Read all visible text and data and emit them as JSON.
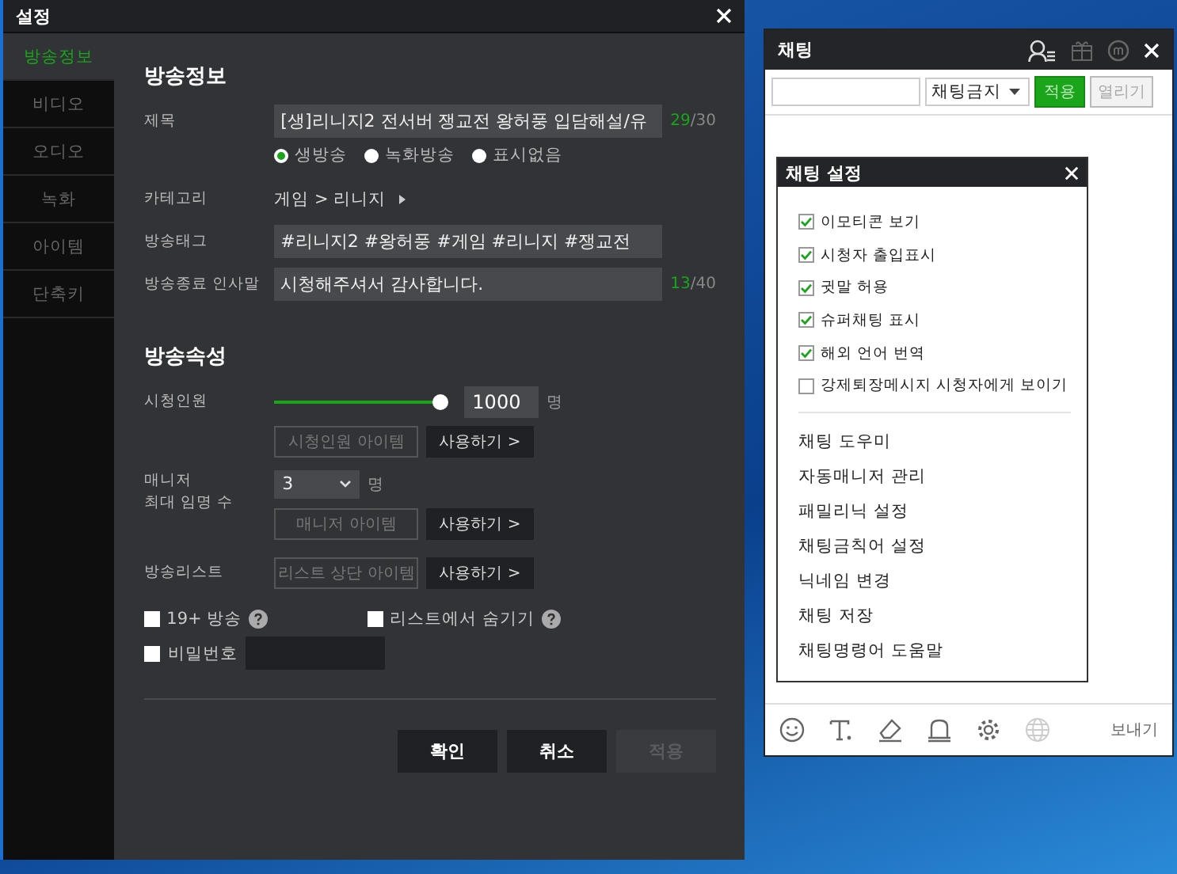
{
  "settings_window": {
    "title": "설정",
    "sidebar": {
      "items": [
        {
          "label": "방송정보",
          "selected": true
        },
        {
          "label": "비디오",
          "selected": false
        },
        {
          "label": "오디오",
          "selected": false
        },
        {
          "label": "녹화",
          "selected": false
        },
        {
          "label": "아이템",
          "selected": false
        },
        {
          "label": "단축키",
          "selected": false
        }
      ]
    },
    "broadcast_info": {
      "heading": "방송정보",
      "title_field": {
        "label": "제목",
        "value": "[생]리니지2 전서버 쟁교전 왕허풍 입담해설/유",
        "count": "29",
        "max": "/30"
      },
      "broadcast_type": [
        {
          "label": "생방송",
          "selected": true
        },
        {
          "label": "녹화방송",
          "selected": false
        },
        {
          "label": "표시없음",
          "selected": false
        }
      ],
      "category": {
        "label": "카테고리",
        "value": "게임 > 리니지"
      },
      "tags": {
        "label": "방송태그",
        "value": "#리니지2 #왕허풍 #게임 #리니지 #쟁교전"
      },
      "ending_message": {
        "label": "방송종료 인사말",
        "value": "시청해주셔서 감사합니다.",
        "count": "13",
        "max": "/40"
      }
    },
    "broadcast_props": {
      "heading": "방송속성",
      "viewers": {
        "label": "시청인원",
        "level": 1,
        "value": "1000",
        "unit": "명",
        "item": "시청인원 아이템",
        "use": "사용하기 >"
      },
      "managers": {
        "label_lines": [
          "매니저",
          "최대 임명 수"
        ],
        "value": "3",
        "unit": "명",
        "item": "매니저 아이템",
        "use": "사용하기 >"
      },
      "list": {
        "label": "방송리스트",
        "item": "리스트 상단 아이템",
        "use": "사용하기 >"
      },
      "options": [
        {
          "label": "19+ 방송",
          "checked": false,
          "help": true
        },
        {
          "label": "리스트에서 숨기기",
          "checked": false,
          "help": true
        }
      ],
      "password": {
        "label": "비밀번호",
        "checked": false
      }
    },
    "buttons": [
      {
        "label": "확인",
        "disabled": false
      },
      {
        "label": "취소",
        "disabled": false
      },
      {
        "label": "적용",
        "disabled": true
      }
    ]
  },
  "chat_window": {
    "title": "채팅",
    "toolbar": {
      "dropdown": "채팅금지",
      "apply": "적용",
      "open": "열리기"
    },
    "chat_settings": {
      "title": "채팅 설정",
      "options": [
        {
          "label": "이모티콘 보기",
          "checked": true
        },
        {
          "label": "시청자 출입표시",
          "checked": true
        },
        {
          "label": "귓말 허용",
          "checked": true
        },
        {
          "label": "슈퍼채팅 표시",
          "checked": true
        },
        {
          "label": "해외 언어 번역",
          "checked": true
        },
        {
          "label": "강제퇴장메시지 시청자에게 보이기",
          "checked": false
        }
      ],
      "menu": [
        "채팅 도우미",
        "자동매니저 관리",
        "패밀리닉 설정",
        "채팅금칙어 설정",
        "닉네임 변경",
        "채팅 저장",
        "채팅명령어 도움말"
      ]
    },
    "send": "보내기"
  }
}
